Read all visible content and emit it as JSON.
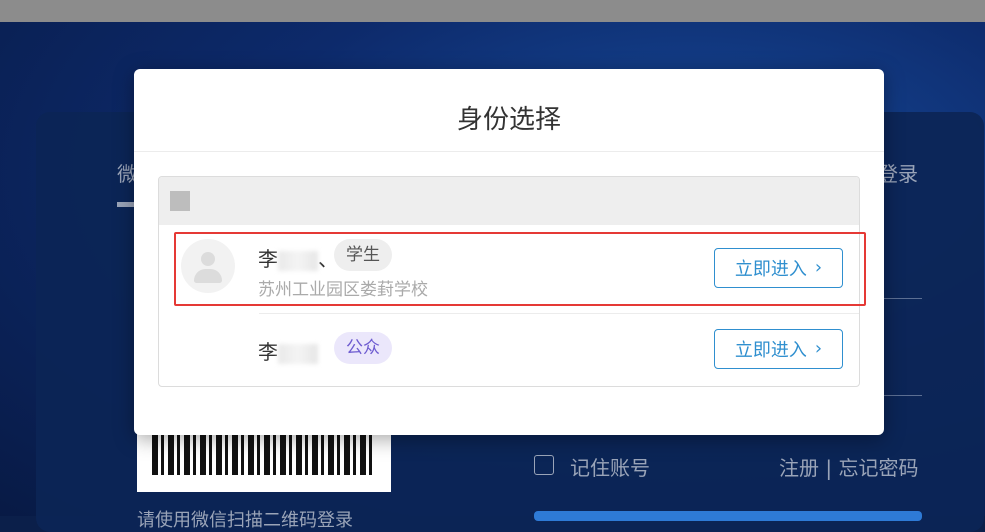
{
  "background": {
    "tab_left": "微",
    "tab_right": "登录",
    "qr_text": "请使用微信扫描二维码登录",
    "remember_label": "记住账号",
    "register_link": "注册",
    "link_separator": "|",
    "forgot_link": "忘记密码"
  },
  "dialog": {
    "title": "身份选择",
    "identities": [
      {
        "name": "李",
        "separator": "、",
        "role": "学生",
        "school": "苏州工业园区娄葑学校",
        "button": "立即进入",
        "icon": "user-avatar-icon"
      },
      {
        "name": "李",
        "role": "公众",
        "button": "立即进入"
      }
    ]
  },
  "colors": {
    "accent": "#2f8fcf",
    "highlight": "#e53935",
    "public_badge": "#6d5bd0"
  }
}
